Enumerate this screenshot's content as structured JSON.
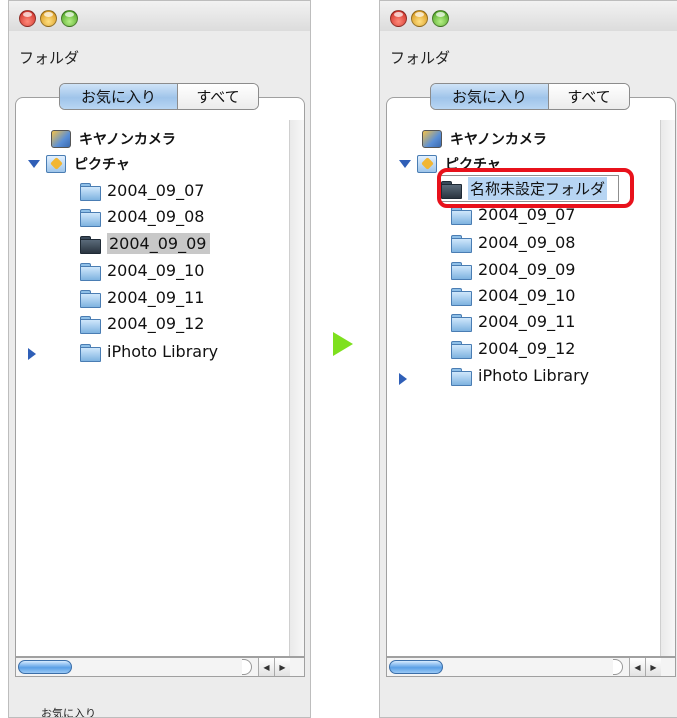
{
  "left": {
    "panel_title": "フォルダ",
    "tabs": [
      {
        "label": "お気に入り",
        "active": true
      },
      {
        "label": "すべて",
        "active": false
      }
    ],
    "tree": [
      {
        "label": "キヤノンカメラ",
        "icon": "camera-icon",
        "level": 0
      },
      {
        "label": "ピクチャ",
        "icon": "pictures-folder-icon",
        "level": 0,
        "expanded": true
      },
      {
        "label": "2004_09_07",
        "icon": "folder-icon",
        "level": 1
      },
      {
        "label": "2004_09_08",
        "icon": "folder-icon",
        "level": 1
      },
      {
        "label": "2004_09_09",
        "icon": "folder-icon",
        "level": 1,
        "selected": true
      },
      {
        "label": "2004_09_10",
        "icon": "folder-icon",
        "level": 1
      },
      {
        "label": "2004_09_11",
        "icon": "folder-icon",
        "level": 1
      },
      {
        "label": "2004_09_12",
        "icon": "folder-icon",
        "level": 1
      },
      {
        "label": "iPhoto Library",
        "icon": "folder-icon",
        "level": 1,
        "collapsed": true
      }
    ],
    "bottom_label": "お気に入り"
  },
  "right": {
    "panel_title": "フォルダ",
    "tabs": [
      {
        "label": "お気に入り",
        "active": true
      },
      {
        "label": "すべて",
        "active": false
      }
    ],
    "new_folder_name": "名称未設定フォルダ",
    "tree": [
      {
        "label": "キヤノンカメラ",
        "icon": "camera-icon",
        "level": 0
      },
      {
        "label": "ピクチャ",
        "icon": "pictures-folder-icon",
        "level": 0,
        "expanded": true
      },
      {
        "label": "2004_09_07",
        "icon": "folder-icon",
        "level": 1
      },
      {
        "label": "2004_09_08",
        "icon": "folder-icon",
        "level": 1
      },
      {
        "label": "2004_09_09",
        "icon": "folder-icon",
        "level": 1
      },
      {
        "label": "2004_09_10",
        "icon": "folder-icon",
        "level": 1
      },
      {
        "label": "2004_09_11",
        "icon": "folder-icon",
        "level": 1
      },
      {
        "label": "2004_09_12",
        "icon": "folder-icon",
        "level": 1
      },
      {
        "label": "iPhoto Library",
        "icon": "folder-icon",
        "level": 1,
        "collapsed": true
      }
    ]
  },
  "colors": {
    "arrow": "#7ee01e",
    "highlight": "#e8111b",
    "selection": "#c8c8c8"
  },
  "transition_icon": "green-arrow-right-icon"
}
